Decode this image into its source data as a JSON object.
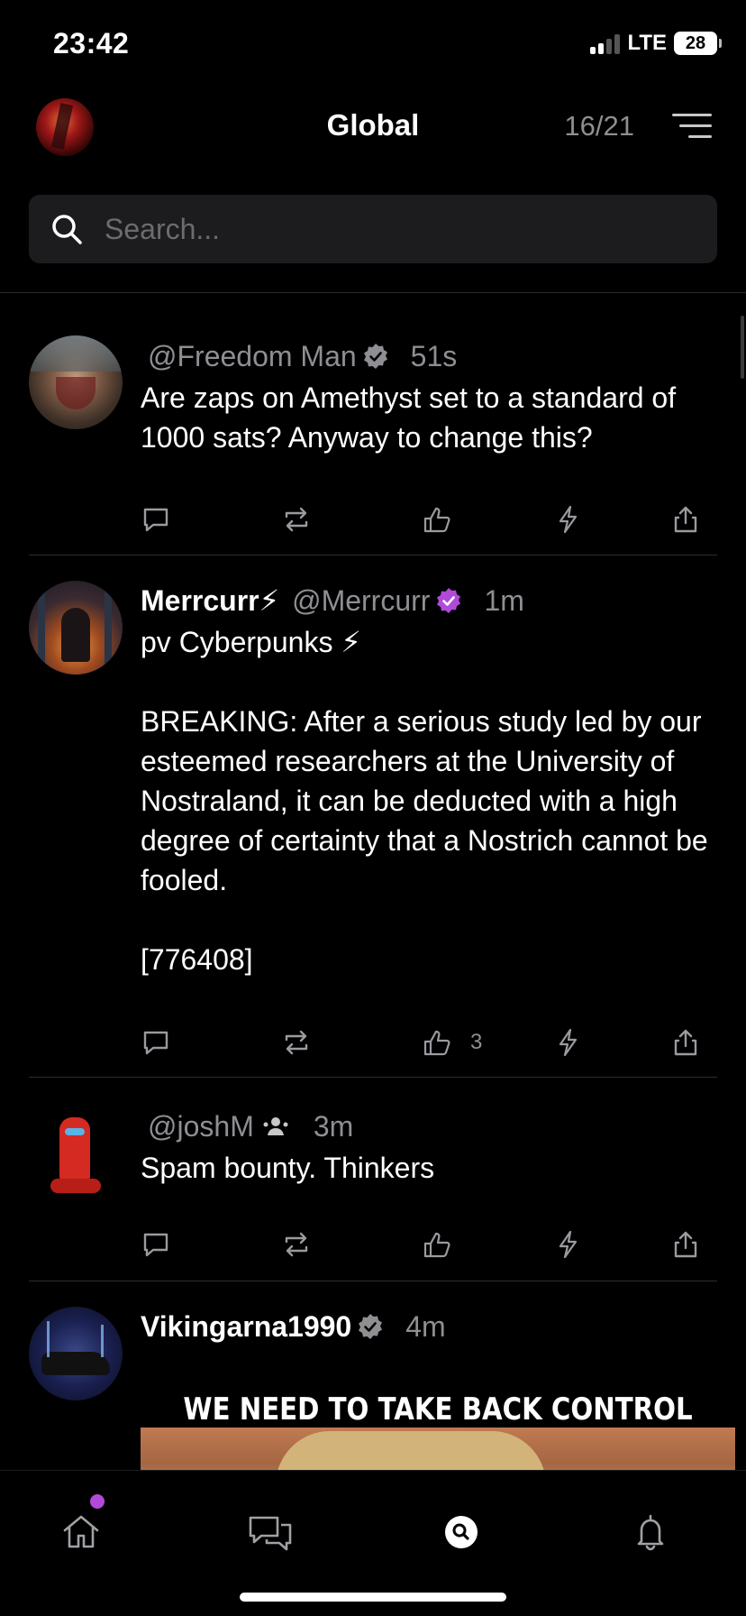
{
  "status_bar": {
    "time": "23:42",
    "network": "LTE",
    "battery": "28"
  },
  "header": {
    "title": "Global",
    "relay_count": "16/21"
  },
  "search": {
    "placeholder": "Search..."
  },
  "posts": [
    {
      "display_name": "",
      "handle": "@Freedom Man",
      "time": "51s",
      "text": "Are zaps on Amethyst set to a standard of 1000 sats? Anyway to change this?",
      "like_count": ""
    },
    {
      "display_name": "Merrcurr⚡",
      "handle": "@Merrcurr",
      "time": "1m",
      "text": "pv Cyberpunks ⚡\n\nBREAKING: After a serious study led by our esteemed researchers at the University of Nostraland, it can be deducted with a high degree of certainty that a Nostrich cannot be fooled.\n\n[776408]",
      "like_count": "3"
    },
    {
      "display_name": "",
      "handle": "@joshM",
      "time": "3m",
      "text": "Spam bounty. Thinkers",
      "like_count": ""
    },
    {
      "display_name": "Vikingarna1990",
      "handle": "",
      "time": "4m",
      "meme_caption": "WE NEED TO TAKE BACK CONTROL"
    }
  ],
  "colors": {
    "accent": "#b24ad8",
    "muted": "#8e8e93",
    "divider": "#2c2c2e"
  },
  "icons": [
    "search-icon",
    "menu-icon",
    "verified-icon",
    "reply-icon",
    "boost-icon",
    "like-icon",
    "zap-icon",
    "share-icon",
    "home-icon",
    "messages-icon",
    "search-nav-icon",
    "bell-icon",
    "follows-icon"
  ]
}
